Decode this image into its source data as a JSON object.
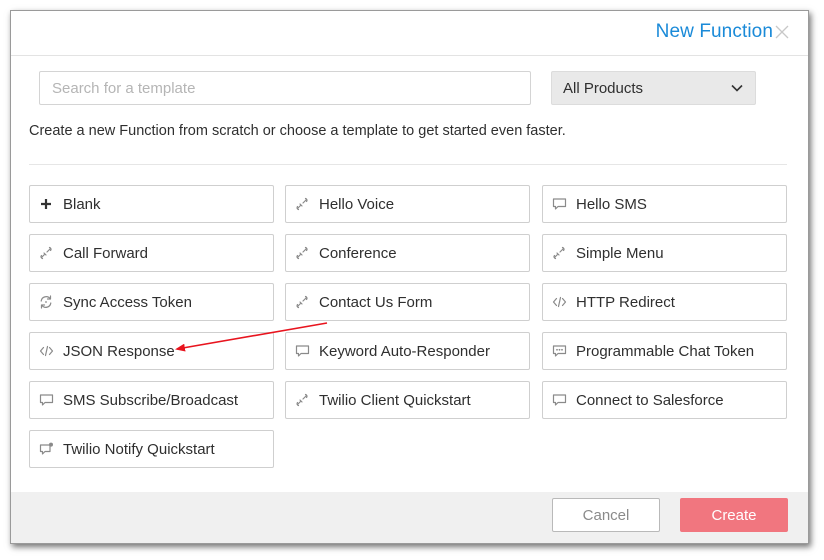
{
  "modal": {
    "title": "New Function",
    "close_icon": "close-icon"
  },
  "search": {
    "placeholder": "Search for a template",
    "value": ""
  },
  "product_filter": {
    "selected": "All Products",
    "icon": "chevron-down-icon"
  },
  "intro": "Create a new Function from scratch or choose a template to get started even faster.",
  "templates": [
    {
      "label": "Blank",
      "icon": "plus-icon"
    },
    {
      "label": "Hello Voice",
      "icon": "phone-icon"
    },
    {
      "label": "Hello SMS",
      "icon": "message-icon"
    },
    {
      "label": "Call Forward",
      "icon": "phone-icon"
    },
    {
      "label": "Conference",
      "icon": "phone-icon"
    },
    {
      "label": "Simple Menu",
      "icon": "phone-icon"
    },
    {
      "label": "Sync Access Token",
      "icon": "sync-icon"
    },
    {
      "label": "Contact Us Form",
      "icon": "phone-icon"
    },
    {
      "label": "HTTP Redirect",
      "icon": "code-icon"
    },
    {
      "label": "JSON Response",
      "icon": "code-icon"
    },
    {
      "label": "Keyword Auto-Responder",
      "icon": "message-icon"
    },
    {
      "label": "Programmable Chat Token",
      "icon": "chat-icon"
    },
    {
      "label": "SMS Subscribe/Broadcast",
      "icon": "message-icon"
    },
    {
      "label": "Twilio Client Quickstart",
      "icon": "phone-icon"
    },
    {
      "label": "Connect to Salesforce",
      "icon": "message-icon"
    },
    {
      "label": "Twilio Notify Quickstart",
      "icon": "notify-icon"
    }
  ],
  "footer": {
    "cancel_label": "Cancel",
    "create_label": "Create"
  },
  "colors": {
    "title": "#1a8ad8",
    "create_button": "#f1767f",
    "annotation_arrow": "#e8141e"
  }
}
